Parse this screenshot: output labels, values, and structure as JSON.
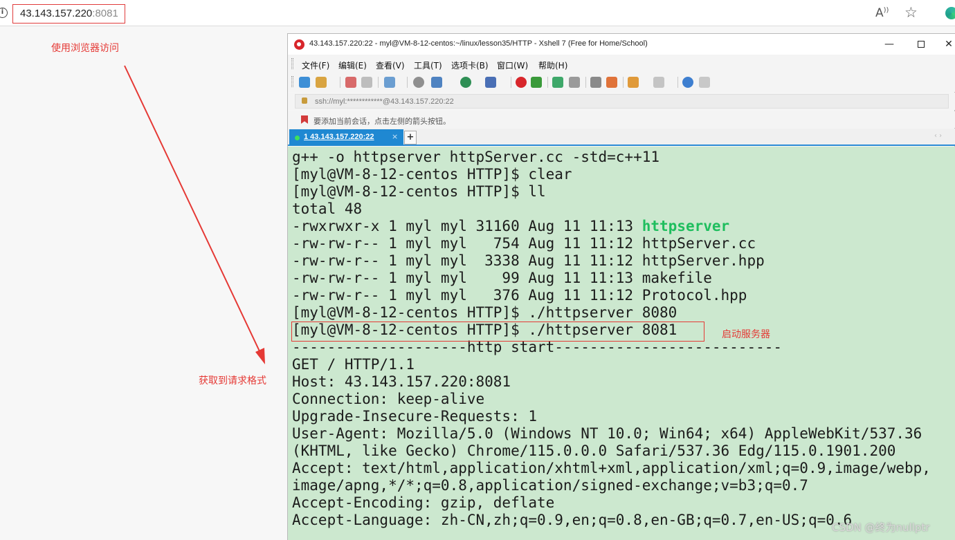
{
  "browser": {
    "url_host": "43.143.157.220",
    "url_port": ":8081"
  },
  "annotations": {
    "browser_note": "使用浏览器访问",
    "request_note": "获取到请求格式",
    "server_note": "启动服务器"
  },
  "xshell": {
    "title": "43.143.157.220:22 - myl@VM-8-12-centos:~/linux/lesson35/HTTP - Xshell 7 (Free for Home/School)",
    "menu": [
      "文件(F)",
      "编辑(E)",
      "查看(V)",
      "工具(T)",
      "选项卡(B)",
      "窗口(W)",
      "帮助(H)"
    ],
    "address": "ssh://myl:************@43.143.157.220:22",
    "hint": "要添加当前会话，点击左侧的箭头按钮。",
    "tab_label": "1 43.143.157.220:22",
    "tab_close": "×",
    "tab_add": "+",
    "tab_scroll": "‹ ›"
  },
  "terminal": {
    "lines": [
      {
        "pre": "g++ -o httpserver httpServer.cc -std=c++11",
        "exec": "",
        "post": ""
      },
      {
        "pre": "[myl@VM-8-12-centos HTTP]$ clear",
        "exec": "",
        "post": ""
      },
      {
        "pre": "[myl@VM-8-12-centos HTTP]$ ll",
        "exec": "",
        "post": ""
      },
      {
        "pre": "total 48",
        "exec": "",
        "post": ""
      },
      {
        "pre": "-rwxrwxr-x 1 myl myl 31160 Aug 11 11:13 ",
        "exec": "httpserver",
        "post": ""
      },
      {
        "pre": "-rw-rw-r-- 1 myl myl   754 Aug 11 11:12 httpServer.cc",
        "exec": "",
        "post": ""
      },
      {
        "pre": "-rw-rw-r-- 1 myl myl  3338 Aug 11 11:12 httpServer.hpp",
        "exec": "",
        "post": ""
      },
      {
        "pre": "-rw-rw-r-- 1 myl myl    99 Aug 11 11:13 makefile",
        "exec": "",
        "post": ""
      },
      {
        "pre": "-rw-rw-r-- 1 myl myl   376 Aug 11 11:12 Protocol.hpp",
        "exec": "",
        "post": ""
      },
      {
        "pre": "[myl@VM-8-12-centos HTTP]$ ./httpserver 8080",
        "exec": "",
        "post": ""
      },
      {
        "pre": "[myl@VM-8-12-centos HTTP]$ ./httpserver 8081",
        "exec": "",
        "post": ""
      },
      {
        "pre": "--------------------http start--------------------------",
        "exec": "",
        "post": ""
      },
      {
        "pre": "GET / HTTP/1.1",
        "exec": "",
        "post": ""
      },
      {
        "pre": "Host: 43.143.157.220:8081",
        "exec": "",
        "post": ""
      },
      {
        "pre": "Connection: keep-alive",
        "exec": "",
        "post": ""
      },
      {
        "pre": "Upgrade-Insecure-Requests: 1",
        "exec": "",
        "post": ""
      },
      {
        "pre": "User-Agent: Mozilla/5.0 (Windows NT 10.0; Win64; x64) AppleWebKit/537.36",
        "exec": "",
        "post": ""
      },
      {
        "pre": "(KHTML, like Gecko) Chrome/115.0.0.0 Safari/537.36 Edg/115.0.1901.200",
        "exec": "",
        "post": ""
      },
      {
        "pre": "Accept: text/html,application/xhtml+xml,application/xml;q=0.9,image/webp,",
        "exec": "",
        "post": ""
      },
      {
        "pre": "image/apng,*/*;q=0.8,application/signed-exchange;v=b3;q=0.7",
        "exec": "",
        "post": ""
      },
      {
        "pre": "Accept-Encoding: gzip, deflate",
        "exec": "",
        "post": ""
      },
      {
        "pre": "Accept-Language: zh-CN,zh;q=0.9,en;q=0.8,en-GB;q=0.7,en-US;q=0.6",
        "exec": "",
        "post": ""
      }
    ]
  },
  "watermark": "CSDN @终为nullptr",
  "colors": {
    "annotation": "#e53935",
    "terminal_bg": "#cce8cf",
    "executable": "#1fbe5e",
    "tab_active": "#1f88d2"
  },
  "icons": [
    "info-icon",
    "read-aloud-icon",
    "favorite-icon",
    "copilot-icon",
    "xshell-app-icon",
    "lock-icon",
    "bookmark-icon"
  ]
}
